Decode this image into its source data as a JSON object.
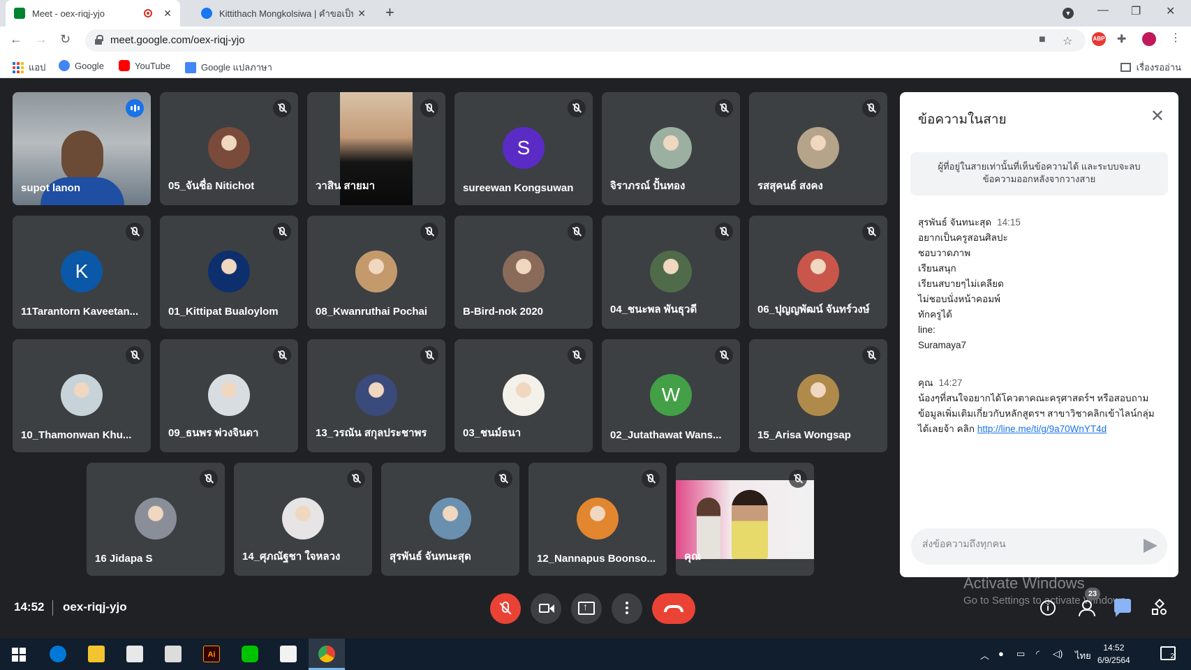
{
  "browser": {
    "tabs": [
      {
        "title": "Meet - oex-riqj-yjo",
        "active": true,
        "recording": true
      },
      {
        "title": "Kittithach Mongkolsiwa | คำขอเป็น",
        "active": false
      }
    ],
    "url": "meet.google.com/oex-riqj-yjo",
    "bookmarks": [
      "แอป",
      "Google",
      "YouTube",
      "Google แปลภาษา"
    ],
    "reading_list": "เรื่องรออ่าน",
    "ext_abp": "ABP"
  },
  "participants": [
    {
      "name": "supot lanon",
      "type": "video",
      "speaking": true
    },
    {
      "name": "05_จันชื่อ Nitichot",
      "type": "photo",
      "color": "#7a4a3a"
    },
    {
      "name": "วาสิน สายมา",
      "type": "video-dark"
    },
    {
      "name": "sureewan Kongsuwan",
      "type": "letter",
      "letter": "S",
      "color": "#5b2bc6"
    },
    {
      "name": "จิราภรณ์ ปั้นทอง",
      "type": "photo",
      "color": "#9bb0a0"
    },
    {
      "name": "รสสุคนธ์ สงคง",
      "type": "photo",
      "color": "#b5a38a"
    },
    {
      "name": "11Tarantorn Kaveetan...",
      "type": "letter",
      "letter": "K",
      "color": "#0b57a8"
    },
    {
      "name": "01_Kittipat Bualoylom",
      "type": "photo",
      "color": "#0d2f6e"
    },
    {
      "name": "08_Kwanruthai Pochai",
      "type": "photo",
      "color": "#c49a6c"
    },
    {
      "name": "B-Bird-nok 2020",
      "type": "photo",
      "color": "#8a6b5a"
    },
    {
      "name": "04_ชนะพล พันธุวดี",
      "type": "photo",
      "color": "#4f6b4a"
    },
    {
      "name": "06_ปุญญพัฒน์ จันทร์วงษ์",
      "type": "photo",
      "color": "#c9564a"
    },
    {
      "name": "10_Thamonwan Khu...",
      "type": "photo",
      "color": "#c7d3d9"
    },
    {
      "name": "09_ธนพร พ่วงจินดา",
      "type": "photo",
      "color": "#d8dde2"
    },
    {
      "name": "13_วรณัน สกุลประชาพร",
      "type": "photo",
      "color": "#3a4a7a"
    },
    {
      "name": "03_ชนม์ธนา",
      "type": "photo",
      "color": "#f4f1ea"
    },
    {
      "name": "02_Jutathawat Wans...",
      "type": "letter",
      "letter": "W",
      "color": "#43a047"
    },
    {
      "name": "15_Arisa Wongsap",
      "type": "photo",
      "color": "#b08a4a"
    },
    {
      "name": "16 Jidapa S",
      "type": "photo",
      "color": "#8a8e99"
    },
    {
      "name": "14_ศุภณัฐชา ใจหลวง",
      "type": "photo",
      "color": "#e6e4e4"
    },
    {
      "name": "สุรพันธ์ จันทนะสุด",
      "type": "photo",
      "color": "#6a90b0"
    },
    {
      "name": "12_Nannapus Boonso...",
      "type": "photo",
      "color": "#e2862f"
    },
    {
      "name": "คุณ",
      "type": "self-video"
    }
  ],
  "chat": {
    "title": "ข้อความในสาย",
    "notice": "ผู้ที่อยู่ในสายเท่านั้นที่เห็นข้อความได้ และระบบจะลบข้อความออกหลังจากวางสาย",
    "messages": [
      {
        "sender": "สุรพันธ์ จันทนะสุด",
        "time": "14:15",
        "body": "อยากเป็นครูสอนศิลปะ\nชอบวาดภาพ\nเรียนสนุก\nเรียนสบายๆไม่เคลียด\nไม่ชอบนั่งหน้าคอมพ์\nทักครูได้\nline:\nSuramaya7"
      },
      {
        "sender": "คุณ",
        "time": "14:27",
        "body": "น้องๆที่สนใจอยากได้โควตาคณะครุศาสตร์ฯ หรือสอบถามข้อมูลเพิ่มเติมเกี่ยวกับหลักสูตรฯ สาขาวิชาคลิกเข้าไลน์กลุ่มได้เลยจ้า คลิก ",
        "link": "http://line.me/ti/g/9a70WnYT4d"
      }
    ],
    "input_placeholder": "ส่งข้อความถึงทุกคน"
  },
  "meeting": {
    "time": "14:52",
    "code": "oex-riqj-yjo",
    "participant_count": "23"
  },
  "watermark": {
    "line1": "Activate Windows",
    "line2": "Go to Settings to activate Windows."
  },
  "taskbar": {
    "lang": "ไทย",
    "time": "14:52",
    "date": "6/9/2564",
    "notifications": "2",
    "apps": [
      "windows-start",
      "edge",
      "file-explorer",
      "store",
      "mail",
      "illustrator",
      "line",
      "photos",
      "chrome"
    ]
  }
}
